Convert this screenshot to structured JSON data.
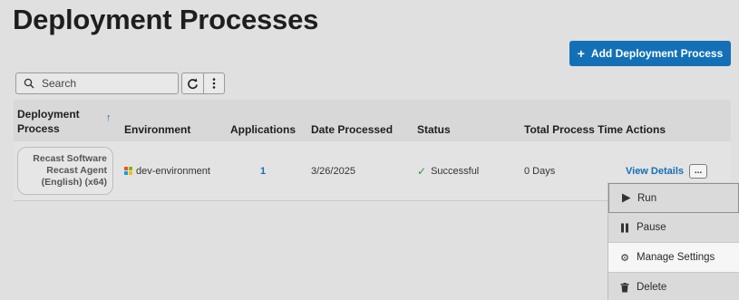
{
  "page": {
    "title": "Deployment Processes"
  },
  "toolbar": {
    "add_button_icon": "+",
    "add_button_label": "Add Deployment Process",
    "search_placeholder": "Search",
    "icons": [
      "search-icon",
      "refresh-icon",
      "more-vertical-icon"
    ]
  },
  "table": {
    "columns": [
      {
        "label": "Deployment Process",
        "sortable": true,
        "sort": "ascending"
      },
      {
        "label": "Environment"
      },
      {
        "label": "Applications"
      },
      {
        "label": "Date Processed"
      },
      {
        "label": "Status"
      },
      {
        "label": "Total Process Time"
      },
      {
        "label": "Actions"
      }
    ],
    "rows": [
      {
        "process_lines": [
          "Recast Software",
          "Recast Agent",
          "(English) (x64)"
        ],
        "environment": "dev-environment",
        "environment_icon": "windows-logo-icon",
        "applications": "1",
        "date_processed": "3/26/2025",
        "status": "Successful",
        "status_icon": "check-icon",
        "total_time": "0 Days",
        "view_details": "View Details",
        "more": "..."
      }
    ]
  },
  "context_menu": {
    "items": [
      {
        "label": "Run",
        "icon": "play-icon"
      },
      {
        "label": "Pause",
        "icon": "pause-icon"
      },
      {
        "label": "Manage Settings",
        "icon": "gear-icon",
        "highlighted": true
      },
      {
        "label": "Delete",
        "icon": "trash-icon"
      }
    ]
  },
  "colors": {
    "accent": "#1470b6",
    "success": "#2e9a3e",
    "background": "#e0e0e0"
  }
}
